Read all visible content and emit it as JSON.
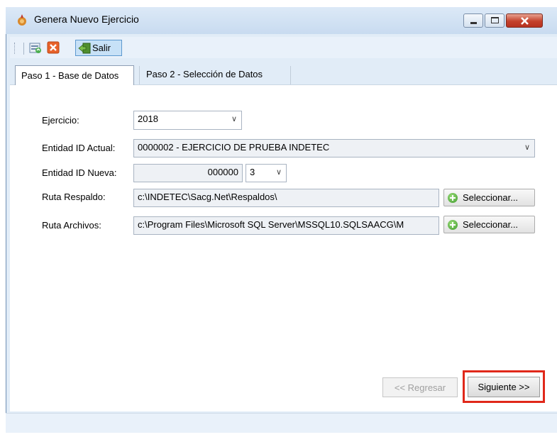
{
  "window": {
    "title": "Genera Nuevo Ejercicio",
    "icon": "app-icon"
  },
  "toolbar": {
    "buttons": [
      {
        "icon": "refresh-icon"
      },
      {
        "icon": "cancel-icon"
      }
    ],
    "salir_label": "Salir"
  },
  "tabs": [
    {
      "label": "Paso 1 - Base de Datos",
      "active": true
    },
    {
      "label": "Paso 2 - Selección de Datos",
      "active": false
    }
  ],
  "form": {
    "ejercicio": {
      "label": "Ejercicio:",
      "value": "2018"
    },
    "entidad_actual": {
      "label": "Entidad ID Actual:",
      "value": "0000002 - EJERCICIO DE PRUEBA INDETEC"
    },
    "entidad_nueva": {
      "label": "Entidad ID Nueva:",
      "value": "000000",
      "suffix": "3"
    },
    "ruta_respaldo": {
      "label": "Ruta Respaldo:",
      "value": "c:\\INDETEC\\Sacg.Net\\Respaldos\\",
      "button": "Seleccionar..."
    },
    "ruta_archivos": {
      "label": "Ruta Archivos:",
      "value": "c:\\Program Files\\Microsoft SQL Server\\MSSQL10.SQLSAACG\\M",
      "button": "Seleccionar..."
    }
  },
  "footer": {
    "back_label": "<< Regresar",
    "next_label": "Siguiente >>"
  },
  "colors": {
    "highlight": "#e0281a",
    "close_button": "#c4412b"
  }
}
